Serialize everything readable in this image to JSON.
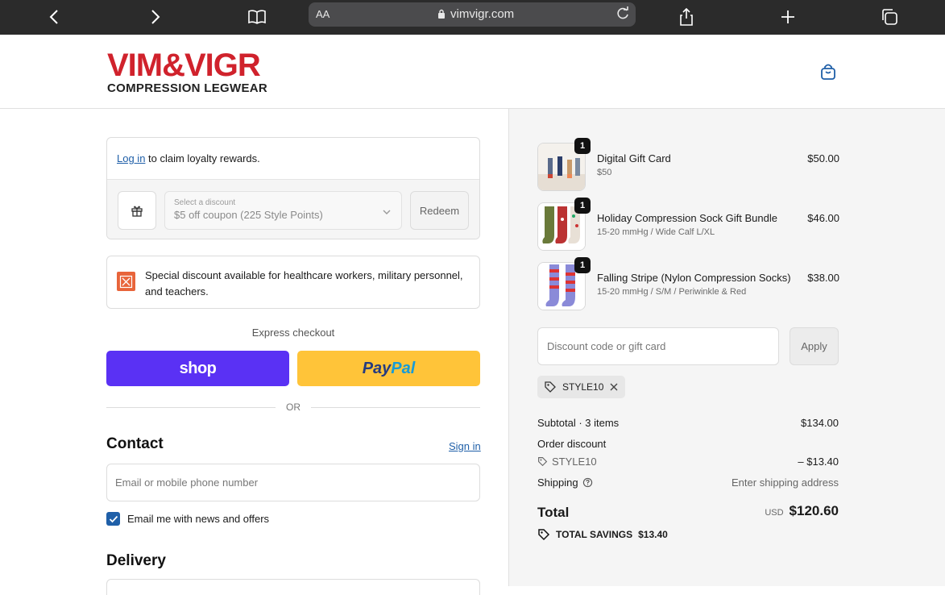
{
  "browser": {
    "text_size_label": "AA",
    "url": "vimvigr.com"
  },
  "brand": {
    "logo": "VIM&VIGR",
    "tagline": "COMPRESSION LEGWEAR",
    "accent_color": "#d0222c"
  },
  "loyalty": {
    "login_link": "Log in",
    "login_text": " to claim loyalty rewards.",
    "select_label": "Select a discount",
    "select_value": "$5 off coupon (225 Style Points)",
    "redeem_label": "Redeem"
  },
  "special": {
    "text": "Special discount available for healthcare workers, military personnel, and teachers."
  },
  "express": {
    "label": "Express checkout",
    "shop_label": "shop",
    "paypal_part1": "Pay",
    "paypal_part2": "Pal",
    "or_label": "OR"
  },
  "contact": {
    "heading": "Contact",
    "sign_in": "Sign in",
    "email_placeholder": "Email or mobile phone number",
    "newsletter_label": "Email me with news and offers",
    "newsletter_checked": true
  },
  "delivery": {
    "heading": "Delivery"
  },
  "cart": {
    "items": [
      {
        "qty": "1",
        "name": "Digital Gift Card",
        "variant": "$50",
        "price": "$50.00"
      },
      {
        "qty": "1",
        "name": "Holiday Compression Sock Gift Bundle",
        "variant": "15-20 mmHg / Wide Calf L/XL",
        "price": "$46.00"
      },
      {
        "qty": "1",
        "name": "Falling Stripe (Nylon Compression Socks)",
        "variant": "15-20 mmHg / S/M / Periwinkle & Red",
        "price": "$38.00"
      }
    ],
    "discount_placeholder": "Discount code or gift card",
    "apply_label": "Apply",
    "applied_code": "STYLE10"
  },
  "summary": {
    "subtotal_label": "Subtotal · 3 items",
    "subtotal_value": "$134.00",
    "order_discount_label": "Order discount",
    "discount_code": "STYLE10",
    "discount_value": "– $13.40",
    "shipping_label": "Shipping",
    "shipping_value": "Enter shipping address",
    "total_label": "Total",
    "currency": "USD",
    "total_value": "$120.60",
    "savings_label": "TOTAL SAVINGS",
    "savings_value": "$13.40"
  }
}
